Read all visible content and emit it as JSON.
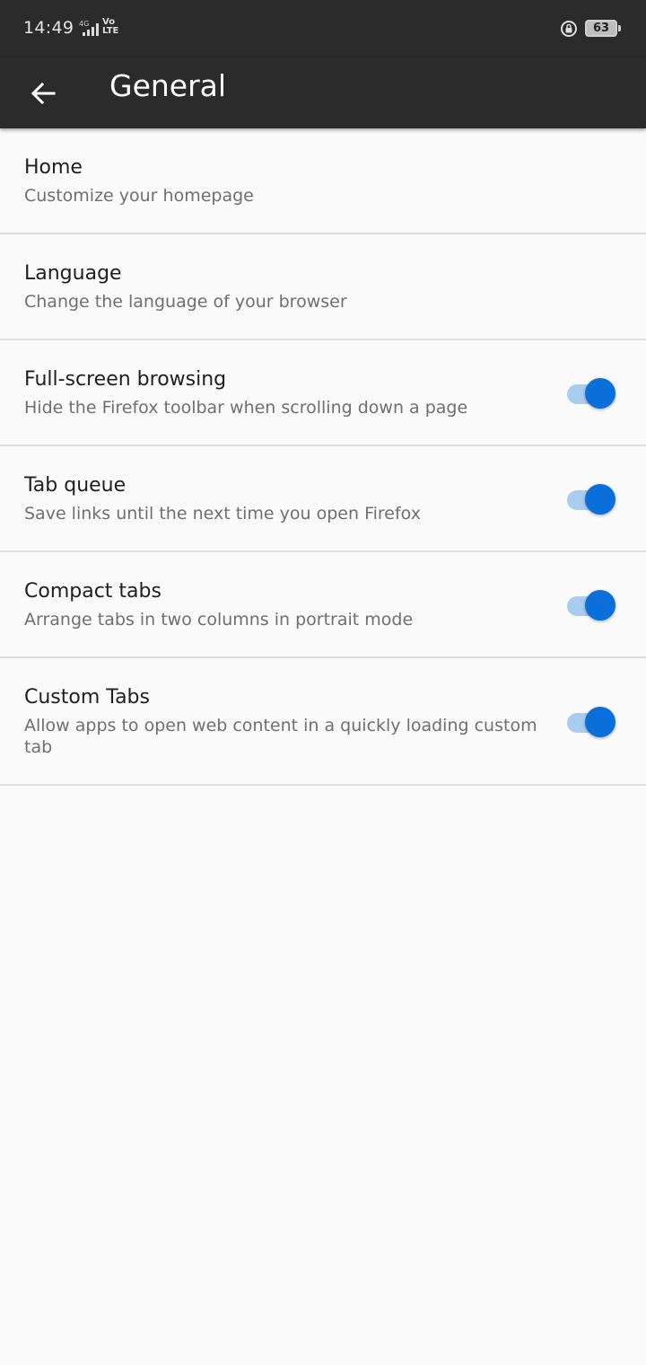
{
  "status_bar": {
    "time": "14:49",
    "network": "4G",
    "volte_line1": "Vo",
    "volte_line2": "LTE",
    "battery_level": "63",
    "icons": [
      "signal-icon",
      "rotation-lock-icon",
      "battery-icon"
    ]
  },
  "toolbar": {
    "title": "General",
    "back_icon": "arrow-left-icon"
  },
  "colors": {
    "toolbar_bg": "#2b2b2b",
    "accent": "#0a6fd8",
    "track_on": "#a9cdef",
    "background": "#fafafa"
  },
  "settings": [
    {
      "title": "Home",
      "subtitle": "Customize your homepage"
    },
    {
      "title": "Language",
      "subtitle": "Change the language of your browser"
    },
    {
      "title": "Full-screen browsing",
      "subtitle": "Hide the Firefox toolbar when scrolling down a page",
      "toggle": "on"
    },
    {
      "title": "Tab queue",
      "subtitle": "Save links until the next time you open Firefox",
      "toggle": "on"
    },
    {
      "title": "Compact tabs",
      "subtitle": "Arrange tabs in two columns in portrait mode",
      "toggle": "on"
    },
    {
      "title": "Custom Tabs",
      "subtitle": "Allow apps to open web content in a quickly loading custom tab",
      "toggle": "on"
    }
  ]
}
